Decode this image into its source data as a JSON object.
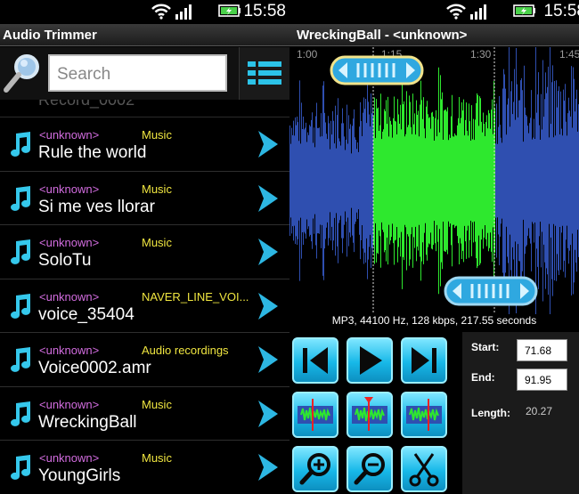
{
  "status": {
    "time": "15:58"
  },
  "left": {
    "title": "Audio Trimmer",
    "search": {
      "placeholder": "Search"
    },
    "partial_title": "Record_0002",
    "songs": [
      {
        "artist": "<unknown>",
        "album": "Music",
        "title": "Rule the world"
      },
      {
        "artist": "<unknown>",
        "album": "Music",
        "title": "Si me ves llorar"
      },
      {
        "artist": "<unknown>",
        "album": "Music",
        "title": "SoloTu"
      },
      {
        "artist": "<unknown>",
        "album": "NAVER_LINE_VOI...",
        "title": "voice_35404"
      },
      {
        "artist": "<unknown>",
        "album": "Audio recordings",
        "title": "Voice0002.amr"
      },
      {
        "artist": "<unknown>",
        "album": "Music",
        "title": "WreckingBall"
      },
      {
        "artist": "<unknown>",
        "album": "Music",
        "title": "YoungGirls"
      }
    ]
  },
  "right": {
    "title": "WreckingBall - <unknown>",
    "timecodes": [
      "1:00",
      "1:15",
      "1:30",
      "1:45"
    ],
    "file_info": "MP3, 44100 Hz, 128 kbps, 217.55 seconds",
    "start_label": "Start:",
    "start_value": "71.68",
    "end_label": "End:",
    "end_value": "91.95",
    "length_label": "Length:",
    "length_value": "20.27"
  },
  "colors": {
    "wave_blue": "#2f4fb0",
    "wave_green": "#2ee82e",
    "artist": "#d36de0",
    "album": "#f0e640",
    "button_cyan": "#17b8e8"
  }
}
